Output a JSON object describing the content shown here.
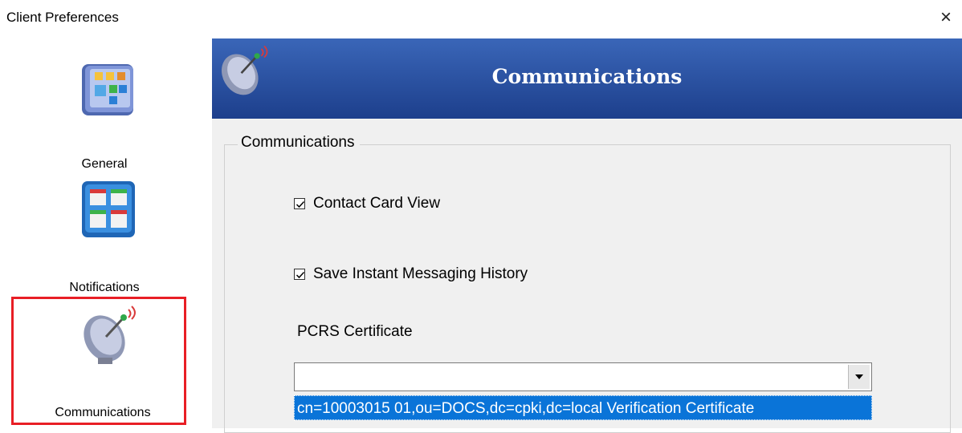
{
  "window": {
    "title": "Client Preferences",
    "close_icon": "×"
  },
  "sidebar": {
    "items": [
      {
        "label": "General",
        "icon": "general-panel-icon"
      },
      {
        "label": "Notifications",
        "icon": "notifications-board-icon"
      },
      {
        "label": "Communications",
        "icon": "satellite-dish-icon",
        "selected": true
      }
    ],
    "selected_color": "#e81e25"
  },
  "header": {
    "title": "Communications",
    "icon": "satellite-dish-icon",
    "color": "#2a4f9e"
  },
  "group": {
    "legend": "Communications",
    "contact_card_view": {
      "label": "Contact Card View",
      "checked": true
    },
    "save_im_history": {
      "label": "Save Instant Messaging History",
      "checked": true
    },
    "certificate": {
      "label": "PCRS Certificate",
      "value": "",
      "options": [
        "cn=10003015 01,ou=DOCS,dc=cpki,dc=local Verification Certificate"
      ],
      "highlight_color": "#0a74d8"
    }
  }
}
